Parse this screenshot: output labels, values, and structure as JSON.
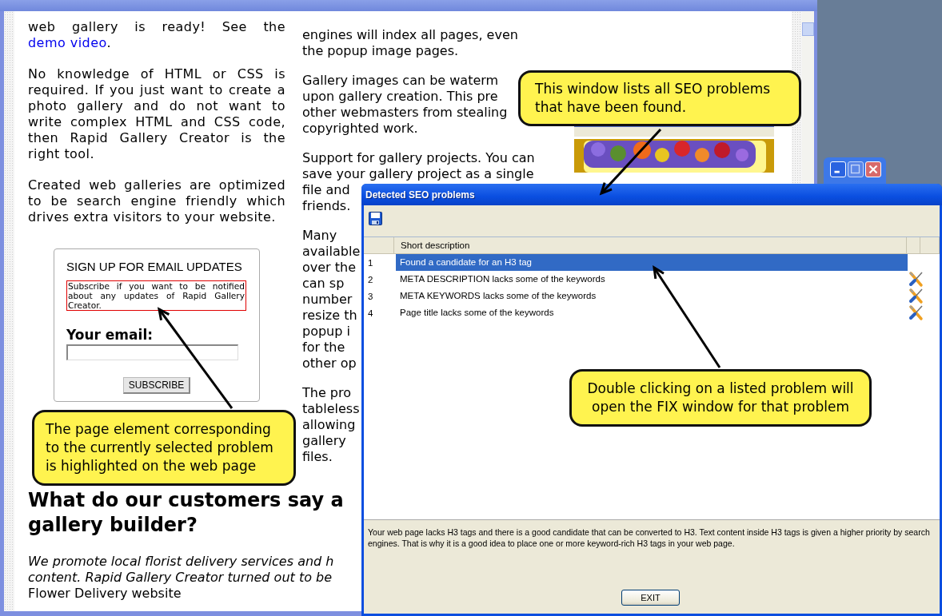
{
  "browser": {
    "intro": {
      "text": "web gallery is ready! See the",
      "link": "demo video",
      "tail": "."
    },
    "paragraphs": [
      "No knowledge of HTML or CSS is required. If you just want to create a photo gallery and do not want to write complex HTML and CSS code, then Rapid Gallery Creator is the right tool.",
      "Created web galleries are optimized to be search engine friendly which drives extra visitors to your website."
    ],
    "signup": {
      "title": "SIGN UP FOR EMAIL UPDATES",
      "notice": "Subscribe if you want to be notified about any updates of Rapid Gallery Creator.",
      "notice_highlighted": true,
      "email_label": "Your email:",
      "button": "SUBSCRIBE"
    },
    "right_column": [
      [
        "engines will index all pages, even",
        "the popup image pages."
      ],
      [
        "Gallery images can be waterm",
        "upon gallery creation. This pre",
        "other webmasters from stealing",
        "copyrighted work."
      ],
      [
        "Support for gallery projects. You can",
        "save your gallery project as a single",
        "file and",
        "friends."
      ],
      [
        "Many",
        "available",
        "over the",
        "can sp",
        "number",
        "resize th",
        "popup i",
        "for the",
        "other op"
      ],
      [
        "The pro",
        "tableless",
        "allowing",
        "gallery",
        "files."
      ]
    ],
    "heading_lines": [
      "What do our customers say a",
      "gallery builder?"
    ],
    "quote_lines": [
      "We promote local florist delivery services and h",
      "content. Rapid Gallery Creator turned out to be"
    ],
    "quote_source": "Flower Delivery website"
  },
  "dialog": {
    "title": "Detected SEO problems",
    "columns": [
      "Short description"
    ],
    "rows": [
      {
        "number": "1",
        "description": "Found a candidate for an H3 tag",
        "selected": true,
        "fix_icon": false
      },
      {
        "number": "2",
        "description": "META DESCRIPTION lacks some of the keywords",
        "selected": false,
        "fix_icon": true
      },
      {
        "number": "3",
        "description": "META KEYWORDS lacks some of the keywords",
        "selected": false,
        "fix_icon": true
      },
      {
        "number": "4",
        "description": "Page title lacks some of the keywords",
        "selected": false,
        "fix_icon": true
      }
    ],
    "details": "Your web page lacks H3 tags and there is a good candidate that can be converted to H3. Text content inside H3 tags is given a higher priority by search engines. That is why it is a good idea to place one or more keyword-rich H3 tags in your web page.",
    "buttons": [
      "EXIT"
    ]
  },
  "callouts": [
    {
      "text": "This window lists all SEO problems that have been found."
    },
    {
      "text": "Double clicking on a listed problem will open the FIX window for that problem"
    },
    {
      "text": "The page element corresponding to the currently selected problem is highlighted on the web page"
    }
  ]
}
